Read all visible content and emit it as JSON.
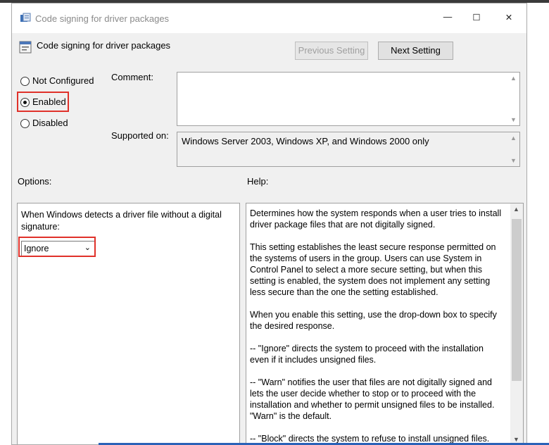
{
  "window": {
    "title": "Code signing for driver packages",
    "controls": {
      "minimize": "—",
      "maximize": "☐",
      "close": "✕"
    }
  },
  "header": {
    "title": "Code signing for driver packages"
  },
  "nav": {
    "previous": "Previous Setting",
    "next": "Next Setting"
  },
  "state": {
    "options": [
      "Not Configured",
      "Enabled",
      "Disabled"
    ],
    "selected": "Enabled"
  },
  "labels": {
    "comment": "Comment:",
    "supported_on": "Supported on:",
    "options": "Options:",
    "help": "Help:"
  },
  "comment_value": "",
  "supported_value": "Windows Server 2003, Windows XP, and Windows 2000 only",
  "options_panel": {
    "prompt": "When Windows detects a driver file without a digital signature:",
    "dropdown_value": "Ignore"
  },
  "help_paragraphs": [
    "Determines how the system responds when a user tries to install driver package files that are not digitally signed.",
    "This setting establishes the least secure response permitted on the systems of users in the group. Users can use System in Control Panel to select a more secure setting, but when this setting is enabled, the system does not implement any setting less secure than the one the setting established.",
    "When you enable this setting, use the drop-down box to specify the desired response.",
    "--   \"Ignore\" directs the system to proceed with the installation even if it includes unsigned files.",
    "--   \"Warn\" notifies the user that files are not digitally signed and lets the user decide whether to stop or to proceed with the installation and whether to permit unsigned files to be installed. \"Warn\" is the default.",
    "--   \"Block\" directs the system to refuse to install unsigned files."
  ],
  "highlight_color": "#e0312a"
}
